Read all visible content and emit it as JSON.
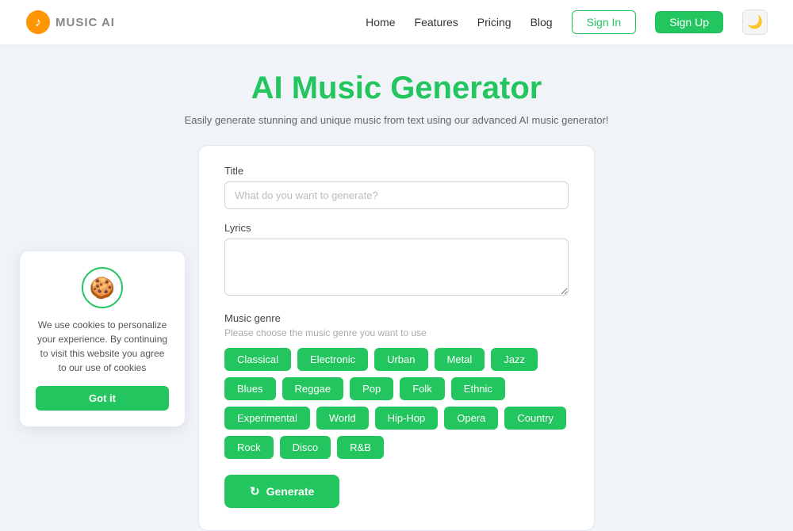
{
  "nav": {
    "logo_text": "MUSIC AI",
    "links": [
      {
        "label": "Home",
        "id": "home"
      },
      {
        "label": "Features",
        "id": "features"
      },
      {
        "label": "Pricing",
        "id": "pricing"
      },
      {
        "label": "Blog",
        "id": "blog"
      }
    ],
    "signin_label": "Sign In",
    "signup_label": "Sign Up",
    "dark_icon": "🌙"
  },
  "page": {
    "title": "AI Music Generator",
    "subtitle": "Easily generate stunning and unique music from text using our advanced AI music generator!"
  },
  "form": {
    "title_label": "Title",
    "title_placeholder": "What do you want to generate?",
    "lyrics_label": "Lyrics",
    "lyrics_placeholder": "",
    "genre_label": "Music genre",
    "genre_hint": "Please choose the music genre you want to use",
    "genres": [
      "Classical",
      "Electronic",
      "Urban",
      "Metal",
      "Jazz",
      "Blues",
      "Reggae",
      "Pop",
      "Folk",
      "Ethnic",
      "Experimental",
      "World",
      "Hip-Hop",
      "Opera",
      "Country",
      "Rock",
      "Disco",
      "R&B"
    ],
    "generate_label": "Generate"
  },
  "cookie": {
    "icon": "🍪",
    "text": "We use cookies to personalize your experience. By continuing to visit this website you agree to our use of cookies",
    "button_label": "Got it"
  }
}
